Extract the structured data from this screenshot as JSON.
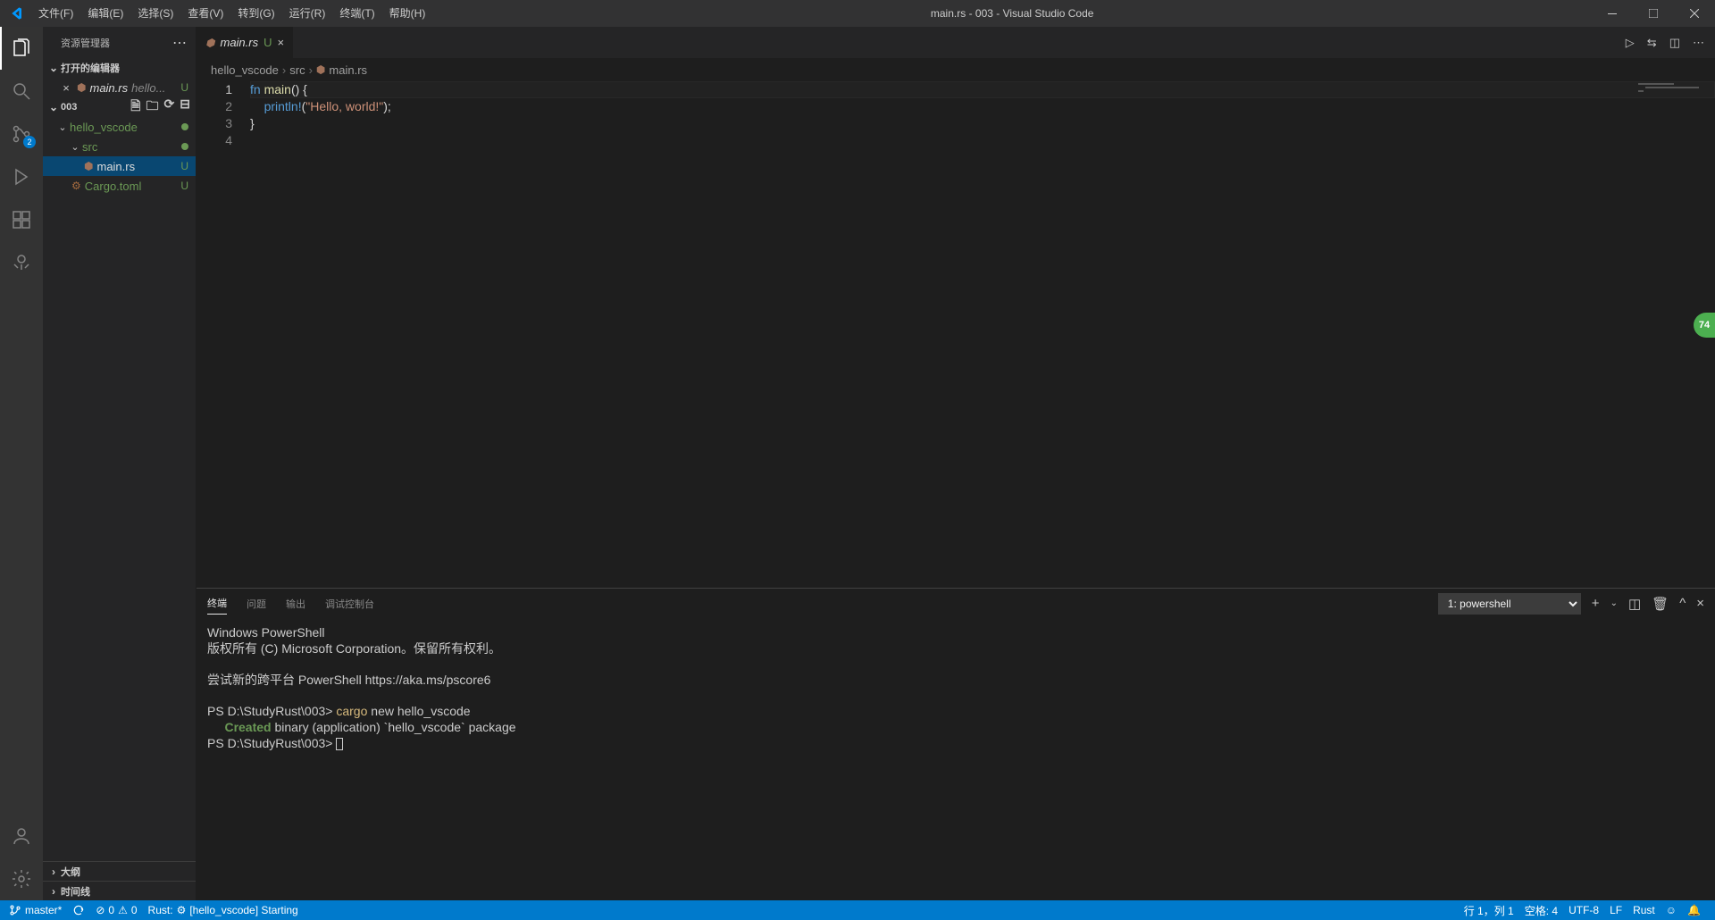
{
  "window": {
    "title": "main.rs - 003 - Visual Studio Code"
  },
  "menu": [
    "文件(F)",
    "编辑(E)",
    "选择(S)",
    "查看(V)",
    "转到(G)",
    "运行(R)",
    "终端(T)",
    "帮助(H)"
  ],
  "activitybar": {
    "scm_badge": "2"
  },
  "sidebar": {
    "title": "资源管理器",
    "open_editors": {
      "label": "打开的编辑器",
      "items": [
        {
          "name": "main.rs",
          "path": "hello...",
          "status": "U"
        }
      ]
    },
    "folder": {
      "name": "003",
      "tree": [
        {
          "level": 0,
          "type": "folder",
          "name": "hello_vscode",
          "git": "dot"
        },
        {
          "level": 1,
          "type": "folder",
          "name": "src",
          "git": "dot"
        },
        {
          "level": 2,
          "type": "file",
          "name": "main.rs",
          "git": "U",
          "selected": true,
          "icon": "rust"
        },
        {
          "level": 1,
          "type": "file",
          "name": "Cargo.toml",
          "git": "U",
          "icon": "cargo"
        }
      ]
    },
    "outline": "大纲",
    "timeline": "时间线"
  },
  "tabs": [
    {
      "name": "main.rs",
      "status": "U"
    }
  ],
  "editor_actions_tooltip": "",
  "breadcrumb": [
    "hello_vscode",
    "src",
    "main.rs"
  ],
  "code": {
    "lines": [
      {
        "n": 1,
        "html": "<span class='kw'>fn</span> <span class='fn'>main</span>() {"
      },
      {
        "n": 2,
        "html": "    <span class='mac'>println!</span>(<span class='str'>\"Hello, world!\"</span>);"
      },
      {
        "n": 3,
        "html": "}"
      },
      {
        "n": 4,
        "html": ""
      }
    ]
  },
  "panel": {
    "tabs": [
      "终端",
      "问题",
      "输出",
      "调试控制台"
    ],
    "active_tab": 0,
    "shell_selected": "1: powershell",
    "terminal": {
      "line1": "Windows PowerShell",
      "line2": "版权所有 (C) Microsoft Corporation。保留所有权利。",
      "line3": "尝试新的跨平台 PowerShell https://aka.ms/pscore6",
      "prompt1": "PS D:\\StudyRust\\003> ",
      "cmd_cargo": "cargo",
      "cmd_rest": " new hello_vscode",
      "created": "     Created",
      "created_rest": " binary (application) `hello_vscode` package",
      "prompt2": "PS D:\\StudyRust\\003> "
    }
  },
  "statusbar": {
    "branch": "master*",
    "errors": "0",
    "warnings": "0",
    "rust": "Rust:",
    "rust_status": "[hello_vscode] Starting",
    "ln_col": "行 1，列 1",
    "spaces": "空格: 4",
    "encoding": "UTF-8",
    "eol": "LF",
    "lang": "Rust"
  },
  "float_badge": "74"
}
